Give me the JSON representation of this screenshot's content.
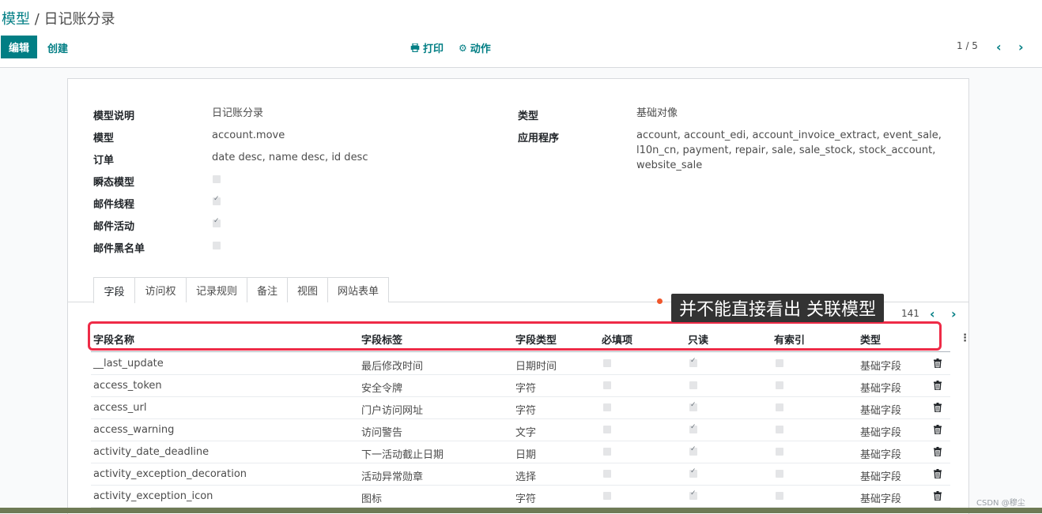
{
  "breadcrumb": {
    "parent": "模型",
    "separator": " / ",
    "current": "日记账分录"
  },
  "toolbar": {
    "edit_label": "编辑",
    "create_label": "创建",
    "print_label": "打印",
    "action_label": "动作"
  },
  "pager": {
    "value": "1 / 5"
  },
  "form": {
    "left": [
      {
        "label": "模型说明",
        "value": "日记账分录"
      },
      {
        "label": "模型",
        "value": "account.move"
      },
      {
        "label": "订单",
        "value": "date desc, name desc, id desc"
      },
      {
        "label": "瞬态模型",
        "checked": false
      },
      {
        "label": "邮件线程",
        "checked": true
      },
      {
        "label": "邮件活动",
        "checked": true
      },
      {
        "label": "邮件黑名单",
        "checked": false
      }
    ],
    "right": [
      {
        "label": "类型",
        "value": "基础对像"
      },
      {
        "label": "应用程序",
        "value_lines": [
          "account, account_edi, account_invoice_extract, event_sale,",
          "l10n_cn, payment, repair, sale, sale_stock, stock_account,",
          "website_sale"
        ]
      }
    ]
  },
  "tabs": [
    "字段",
    "访问权",
    "记录规则",
    "备注",
    "视图",
    "网站表单"
  ],
  "annotation": {
    "text": "并不能直接看出 关联模型"
  },
  "list_pager": {
    "value": "141"
  },
  "table": {
    "headers": [
      "字段名称",
      "字段标签",
      "字段类型",
      "必填项",
      "只读",
      "有索引",
      "类型"
    ],
    "rows": [
      {
        "name": "__last_update",
        "label": "最后修改时间",
        "type": "日期时间",
        "required": false,
        "readonly": true,
        "index": false,
        "kind": "基础字段"
      },
      {
        "name": "access_token",
        "label": "安全令牌",
        "type": "字符",
        "required": false,
        "readonly": false,
        "index": false,
        "kind": "基础字段"
      },
      {
        "name": "access_url",
        "label": "门户访问网址",
        "type": "字符",
        "required": false,
        "readonly": true,
        "index": false,
        "kind": "基础字段"
      },
      {
        "name": "access_warning",
        "label": "访问警告",
        "type": "文字",
        "required": false,
        "readonly": true,
        "index": false,
        "kind": "基础字段"
      },
      {
        "name": "activity_date_deadline",
        "label": "下一活动截止日期",
        "type": "日期",
        "required": false,
        "readonly": true,
        "index": false,
        "kind": "基础字段"
      },
      {
        "name": "activity_exception_decoration",
        "label": "活动异常勋章",
        "type": "选择",
        "required": false,
        "readonly": true,
        "index": false,
        "kind": "基础字段"
      },
      {
        "name": "activity_exception_icon",
        "label": "图标",
        "type": "字符",
        "required": false,
        "readonly": true,
        "index": false,
        "kind": "基础字段"
      }
    ]
  },
  "watermark": "CSDN @穆尘",
  "colors": {
    "accent": "#017e84",
    "highlight": "#ee2b47",
    "tooltip_bg": "#333333"
  }
}
